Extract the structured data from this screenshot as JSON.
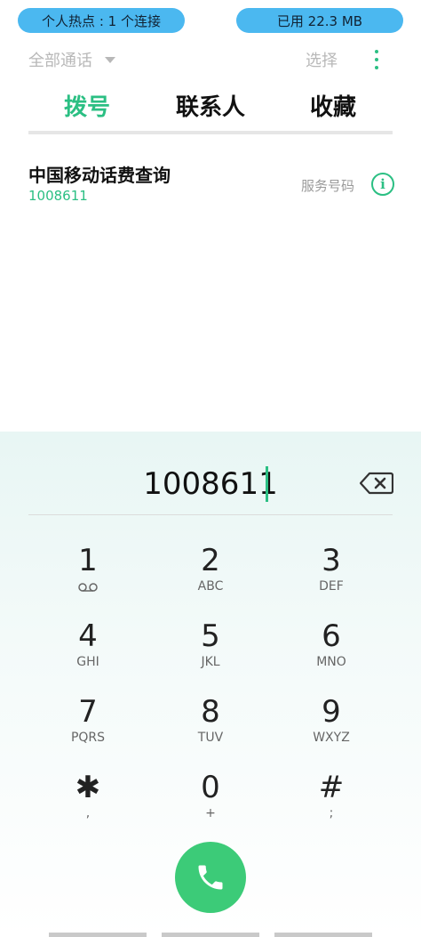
{
  "status": {
    "hotspot": "个人热点 : 1 个连接",
    "data_used": "已用 22.3 MB"
  },
  "header": {
    "filter_label": "全部通话",
    "select_label": "选择",
    "more_icon": "more-vertical-icon"
  },
  "tabs": [
    {
      "label": "拨号",
      "active": true
    },
    {
      "label": "联系人",
      "active": false
    },
    {
      "label": "收藏",
      "active": false
    }
  ],
  "result": {
    "name": "中国移动话费查询",
    "number": "1008611",
    "type": "服务号码"
  },
  "dialer": {
    "input_value": "1008611",
    "keys": [
      {
        "digit": "1",
        "letters": ""
      },
      {
        "digit": "2",
        "letters": "ABC"
      },
      {
        "digit": "3",
        "letters": "DEF"
      },
      {
        "digit": "4",
        "letters": "GHI"
      },
      {
        "digit": "5",
        "letters": "JKL"
      },
      {
        "digit": "6",
        "letters": "MNO"
      },
      {
        "digit": "7",
        "letters": "PQRS"
      },
      {
        "digit": "8",
        "letters": "TUV"
      },
      {
        "digit": "9",
        "letters": "WXYZ"
      },
      {
        "digit": "✱",
        "letters": ","
      },
      {
        "digit": "0",
        "letters": "+"
      },
      {
        "digit": "#",
        "letters": ";"
      }
    ]
  },
  "colors": {
    "accent": "#2bbf83",
    "call": "#3ccb78",
    "pill": "#4bb8f0"
  }
}
